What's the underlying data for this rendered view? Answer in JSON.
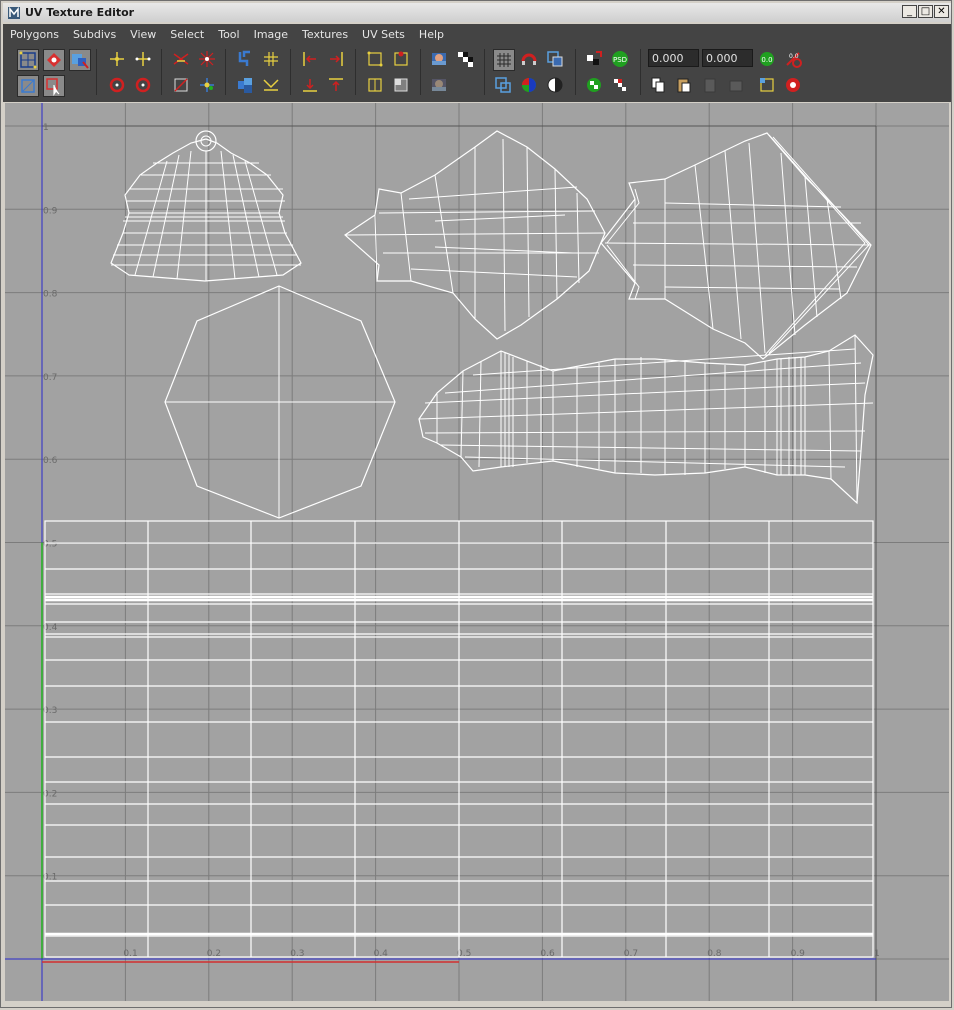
{
  "window": {
    "title": "UV Texture Editor"
  },
  "menu": [
    "Polygons",
    "Subdivs",
    "View",
    "Select",
    "Tool",
    "Image",
    "Textures",
    "UV Sets",
    "Help"
  ],
  "fields": {
    "u_value": "0.000",
    "v_value": "0.000"
  },
  "icons": {
    "zero_label": "0.0",
    "psd_label": "PSD"
  },
  "grid_labels": {
    "v": [
      "0.1",
      "0.2",
      "0.3",
      "0.4",
      "0.5",
      "0.6",
      "0.7",
      "0.8",
      "0.9",
      "1"
    ],
    "u": [
      "0.1",
      "0.2",
      "0.3",
      "0.4",
      "0.5",
      "0.6",
      "0.7",
      "0.8",
      "0.9",
      "1"
    ]
  },
  "colors": {
    "viewport_bg": "#a2a2a2",
    "grid": "#7c7c7c",
    "u_axis": "#d23030",
    "v_axis": "#2a2acc",
    "v_axis_low": "#20b020",
    "uv_wire": "#ffffff"
  }
}
